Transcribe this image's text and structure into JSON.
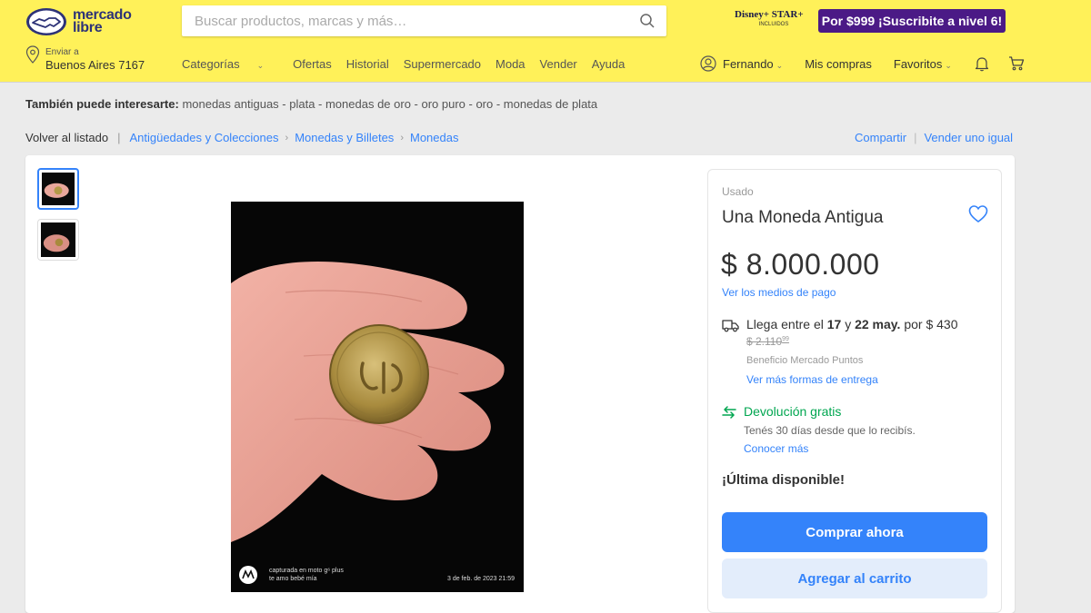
{
  "header": {
    "logo_line1": "mercado",
    "logo_line2": "libre",
    "search_placeholder": "Buscar productos, marcas y más…",
    "promo_logo_text": "Disney+ STAR+",
    "promo_logo_sub": "INCLUIDOS",
    "promo_button": "Por $999 ¡Suscribite a nivel 6!",
    "location_label": "Enviar a",
    "location_value": "Buenos Aires 7167",
    "nav": {
      "categorias": "Categorías",
      "ofertas": "Ofertas",
      "historial": "Historial",
      "supermercado": "Supermercado",
      "moda": "Moda",
      "vender": "Vender",
      "ayuda": "Ayuda"
    },
    "user": {
      "name": "Fernando",
      "mis_compras": "Mis compras",
      "favoritos": "Favoritos"
    }
  },
  "related": {
    "label": "También puede interesarte:",
    "items": "monedas antiguas - plata - monedas de oro - oro puro - oro - monedas de plata"
  },
  "breadcrumb": {
    "back": "Volver al listado",
    "items": [
      "Antigüedades y Colecciones",
      "Monedas y Billetes",
      "Monedas"
    ],
    "share": "Compartir",
    "sell_same": "Vender uno igual"
  },
  "photo": {
    "caption_line1": "capturada en moto g⁶ plus",
    "caption_line2": "te amo bebé mía",
    "timestamp": "3 de feb. de 2023 21:59"
  },
  "product": {
    "condition": "Usado",
    "title": "Una Moneda Antigua",
    "price": "$ 8.000.000",
    "payment_link": "Ver los medios de pago",
    "shipping": {
      "prefix": "Llega entre el ",
      "day1": "17",
      "middle": " y ",
      "day2": "22 may.",
      "suffix": " por $ 430",
      "old_price": "$ 2.110",
      "old_cents": "99",
      "benefit": "Beneficio Mercado Puntos",
      "more_link": "Ver más formas de entrega"
    },
    "returns": {
      "title": "Devolución gratis",
      "detail": "Tenés 30 días desde que lo recibís.",
      "link": "Conocer más"
    },
    "stock": "¡Última disponible!",
    "buy_now": "Comprar ahora",
    "add_to_cart": "Agregar al carrito"
  },
  "colors": {
    "header_bg": "#fff159",
    "accent_blue": "#3483fa",
    "green": "#00a650",
    "promo_purple": "#4b1a86"
  },
  "icons": [
    "handshake-logo-icon",
    "search-icon",
    "location-pin-icon",
    "user-avatar-icon",
    "bell-icon",
    "cart-icon",
    "heart-icon",
    "truck-icon",
    "return-arrow-icon",
    "motorola-logo-icon"
  ]
}
